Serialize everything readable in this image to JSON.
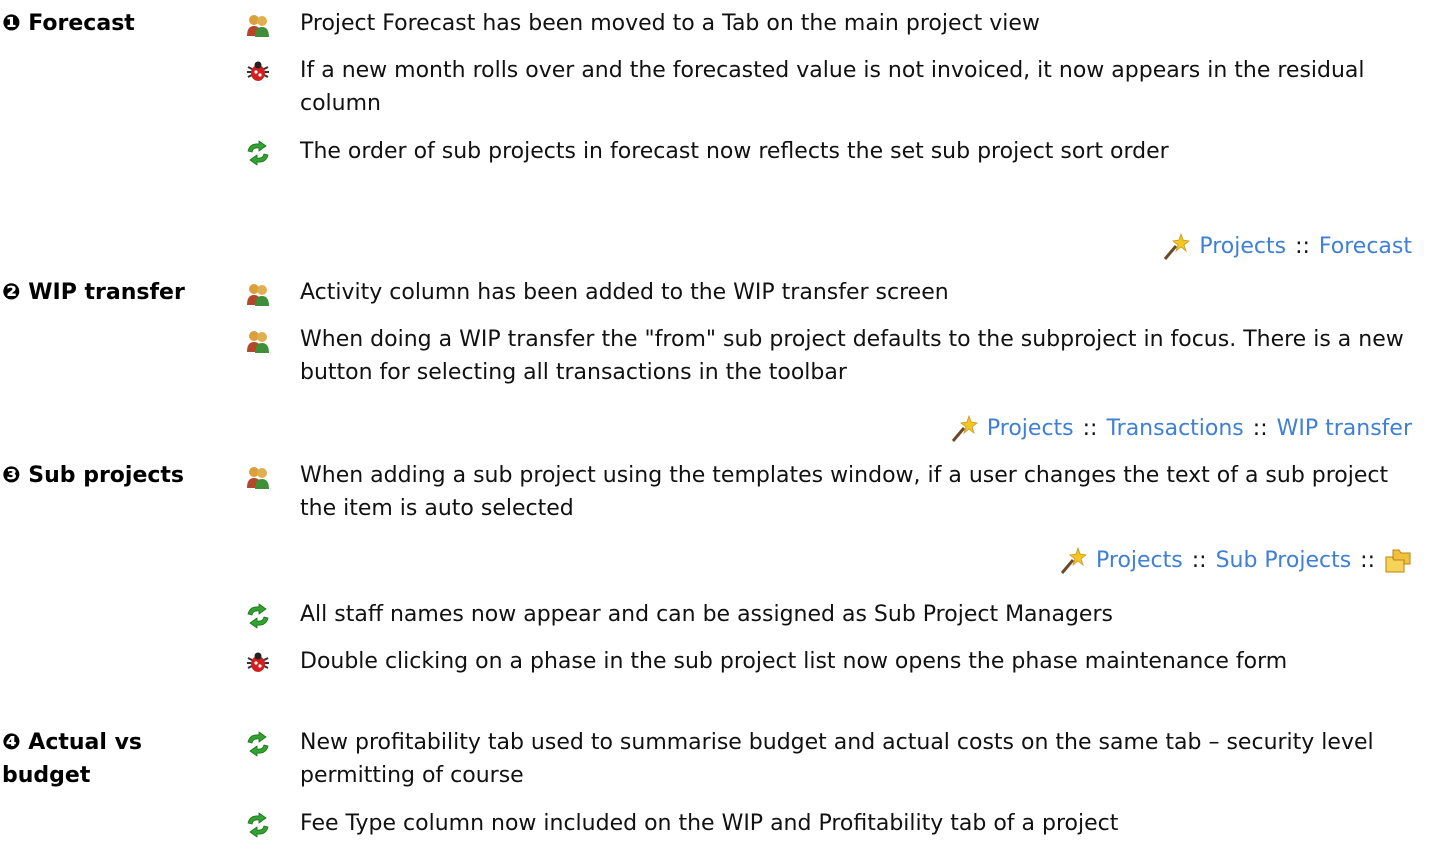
{
  "sections": [
    {
      "label": "❶ Forecast",
      "items": [
        {
          "icon": "people-icon",
          "text": "Project Forecast has been moved to a Tab on the main project view"
        },
        {
          "icon": "bug-icon",
          "text": "If a new month rolls over and the forecasted value is not invoiced, it now appears in the residual column"
        },
        {
          "icon": "refresh-icon",
          "text": "The order of sub projects in forecast now reflects the set sub project sort order"
        }
      ],
      "nav": {
        "parts": [
          "Projects",
          "Forecast"
        ],
        "separator": "::"
      }
    },
    {
      "label": "❷ WIP transfer",
      "items": [
        {
          "icon": "people-icon",
          "text": "Activity column has been added to the WIP transfer screen"
        },
        {
          "icon": "people-icon",
          "text": "When doing a WIP transfer the \"from\" sub project defaults to the subproject in focus.  There is a new button for selecting all transactions in the toolbar"
        }
      ],
      "nav": {
        "parts": [
          "Projects",
          "Transactions",
          "WIP transfer"
        ],
        "separator": "::"
      }
    },
    {
      "label": "❸ Sub projects",
      "items": [
        {
          "icon": "people-icon",
          "text": "When adding a sub project using the templates window, if a user changes the text of a sub project the item is auto selected"
        },
        {
          "icon": "refresh-icon",
          "text": "All staff names now appear and can be assigned as Sub Project Managers"
        },
        {
          "icon": "bug-icon",
          "text": "Double clicking on a phase in the sub project list now opens the phase maintenance form"
        }
      ],
      "nav": {
        "parts": [
          "Projects",
          "Sub Projects"
        ],
        "separator": "::",
        "trailing_icon": "folders-icon"
      }
    },
    {
      "label": "❹ Actual vs budget",
      "items": [
        {
          "icon": "refresh-icon",
          "text": "New profitability tab used to summarise budget and actual costs on the same tab – security level permitting of course"
        },
        {
          "icon": "refresh-icon",
          "text": "Fee Type column now included on the WIP and Profitability tab of a project"
        }
      ]
    }
  ],
  "colors": {
    "link": "#3f7fd6",
    "text": "#111111",
    "bug": "#d41f1f",
    "refresh": "#2fa52f",
    "people": "#c9892a"
  }
}
